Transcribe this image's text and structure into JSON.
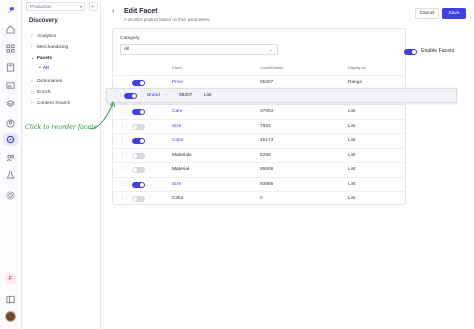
{
  "sidebar": {
    "environment": "Production",
    "section": "Discovery",
    "items": [
      {
        "label": "Analytics"
      },
      {
        "label": "Merchandising"
      },
      {
        "label": "Facets"
      },
      {
        "label": "Dictionaries"
      },
      {
        "label": "Enrich"
      },
      {
        "label": "Content Search"
      }
    ],
    "sub_item": "All",
    "badge": "F"
  },
  "header": {
    "title": "Edit Facet",
    "subtitle": "A shortlist product based on their parameters.",
    "cancel_label": "Cancel",
    "save_label": "Save"
  },
  "filter": {
    "category_label": "Category",
    "category_value": "All",
    "enable_label": "Enable Facets",
    "enabled": true
  },
  "table": {
    "columns": [
      "Facet",
      "Count/Details",
      "Display as"
    ],
    "rows": [
      {
        "facet": "Price",
        "count": "95207",
        "display": "Range",
        "enabled": true
      },
      {
        "facet": "Care",
        "count": "37953",
        "display": "List",
        "enabled": true
      },
      {
        "facet": "Size",
        "count": "7893",
        "display": "List",
        "enabled": false
      },
      {
        "facet": "Color",
        "count": "45174",
        "display": "List",
        "enabled": true
      },
      {
        "facet": "Materials",
        "count": "5295",
        "display": "List",
        "enabled": false
      },
      {
        "facet": "Material",
        "count": "86606",
        "display": "List",
        "enabled": false
      },
      {
        "facet": "Size",
        "count": "93866",
        "display": "List",
        "enabled": true
      },
      {
        "facet": "Color",
        "count": "0",
        "display": "List",
        "enabled": false
      }
    ],
    "dragging_row": {
      "facet": "Brand",
      "count": "95207",
      "display": "List",
      "enabled": true,
      "ellipsis": "···"
    }
  },
  "annotation": "Click to reorder facets",
  "colors": {
    "accent": "#3f42e0",
    "annotation": "#2f8f4d",
    "toggle_off": "#d6d8df"
  }
}
